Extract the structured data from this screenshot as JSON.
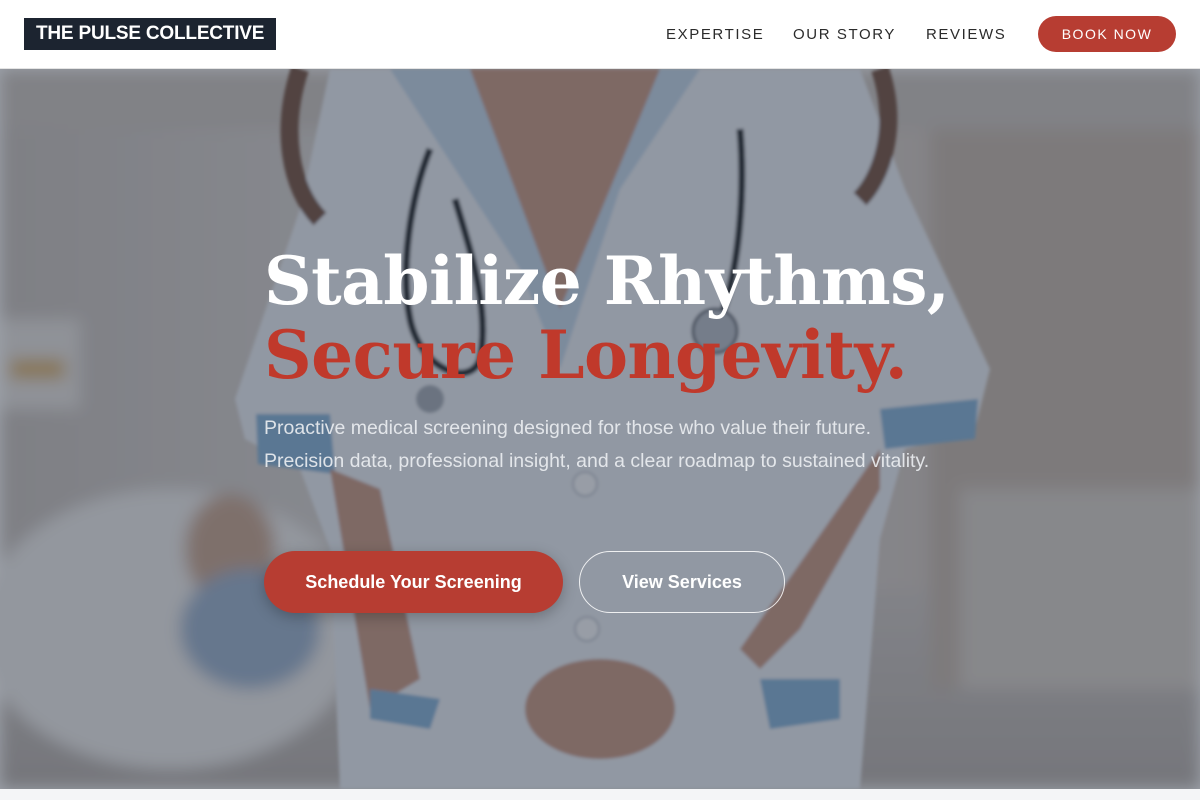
{
  "header": {
    "logo_text": "THE PULSE COLLECTIVE",
    "nav": [
      {
        "label": "EXPERTISE"
      },
      {
        "label": "OUR STORY"
      },
      {
        "label": "REVIEWS"
      }
    ],
    "cta_label": "BOOK NOW"
  },
  "hero": {
    "headline_line1": "Stabilize Rhythms,",
    "headline_line2": "Secure Longevity.",
    "subtext": "Proactive medical screening designed for those who value their future. Precision data, professional insight, and a clear roadmap to sustained vitality.",
    "primary_cta": "Schedule Your Screening",
    "secondary_cta": "View Services",
    "background_image": "nurse-with-stethoscope-photo"
  },
  "colors": {
    "accent": "#b73d32",
    "headline_accent": "#c0392b",
    "logo_background": "#1c2430",
    "header_background": "#ffffff"
  }
}
